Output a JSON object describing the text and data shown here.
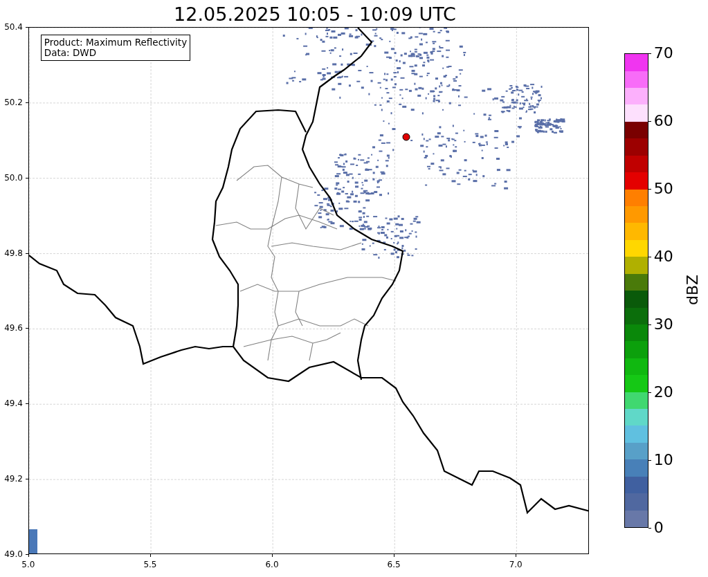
{
  "title": "12.05.2025 10:05 - 10:09 UTC",
  "legend": {
    "lines": [
      "Product: Maximum Reflectivity",
      "Data: DWD"
    ]
  },
  "x_axis": {
    "ticks": [
      "5.0",
      "5.5",
      "6.0",
      "6.5",
      "7.0"
    ]
  },
  "y_axis": {
    "ticks": [
      "50.4",
      "50.2",
      "50.0",
      "49.8",
      "49.6",
      "49.4",
      "49.2",
      "49.0"
    ]
  },
  "colorbar": {
    "label": "dBZ",
    "ticks": [
      "70",
      "60",
      "50",
      "40",
      "30",
      "20",
      "10",
      "0"
    ],
    "segments": [
      {
        "color": "#6878a8"
      },
      {
        "color": "#5068a0"
      },
      {
        "color": "#4060a0"
      },
      {
        "color": "#4880b8"
      },
      {
        "color": "#58a0c8"
      },
      {
        "color": "#60c0e0"
      },
      {
        "color": "#60d8c8"
      },
      {
        "color": "#40d870"
      },
      {
        "color": "#15c815"
      },
      {
        "color": "#10b810"
      },
      {
        "color": "#0ca00c"
      },
      {
        "color": "#0a880a"
      },
      {
        "color": "#0b6e0b"
      },
      {
        "color": "#0a5a0a"
      },
      {
        "color": "#4a7a0a"
      },
      {
        "color": "#b0b000"
      },
      {
        "color": "#ffd700"
      },
      {
        "color": "#ffb800"
      },
      {
        "color": "#ff9900"
      },
      {
        "color": "#ff7f00"
      },
      {
        "color": "#e40000"
      },
      {
        "color": "#c00000"
      },
      {
        "color": "#9c0000"
      },
      {
        "color": "#7a0000"
      },
      {
        "color": "#fde0fd"
      },
      {
        "color": "#fcb0fc"
      },
      {
        "color": "#f86cf8"
      },
      {
        "color": "#f035f0"
      }
    ]
  }
}
